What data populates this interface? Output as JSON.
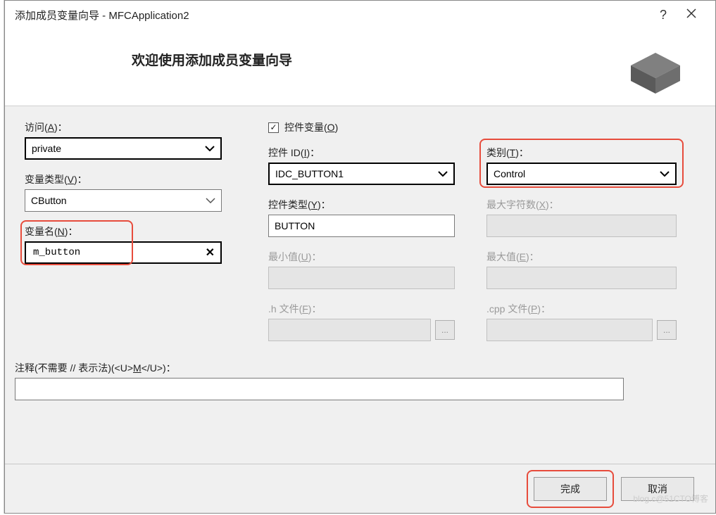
{
  "titlebar": {
    "title": "添加成员变量向导 - MFCApplication2"
  },
  "banner": {
    "heading": "欢迎使用添加成员变量向导"
  },
  "labels": {
    "access": "访问(A)：",
    "varType": "变量类型(V)：",
    "varName": "变量名(N)：",
    "controlVar": "控件变量(O)",
    "controlId": "控件 ID(I)：",
    "controlType": "控件类型(Y)：",
    "minVal": "最小值(U)：",
    "hFile": ".h 文件(F)：",
    "category": "类别(T)：",
    "maxChars": "最大字符数(X)：",
    "maxVal": "最大值(E)：",
    "cppFile": ".cpp 文件(P)：",
    "comment": "注释(不需要 // 表示法)(<U>M</U>)："
  },
  "values": {
    "access": "private",
    "varType": "CButton",
    "varName": "m_button",
    "controlId": "IDC_BUTTON1",
    "controlType": "BUTTON",
    "category": "Control"
  },
  "checkbox": {
    "controlVarChecked": "✓"
  },
  "buttons": {
    "finish": "完成",
    "cancel": "取消"
  },
  "watermark": "blog.c@51CTO博客"
}
